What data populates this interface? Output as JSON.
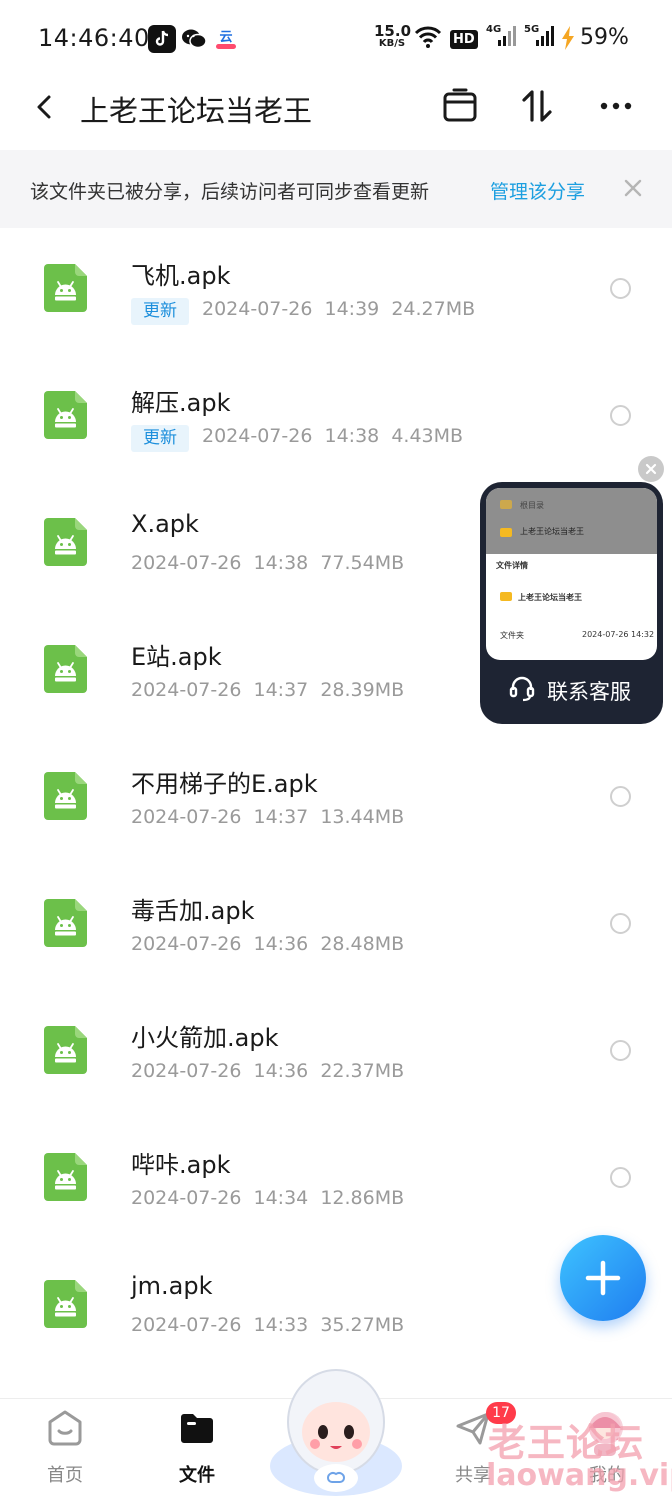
{
  "status_bar": {
    "time": "14:46:40",
    "net_speed_value": "15.0",
    "net_speed_unit": "KB/S",
    "hd_label": "HD",
    "signal1_label": "4G",
    "signal2_label": "5G",
    "battery": "59%",
    "app_icons": [
      "tiktok-icon",
      "wechat-icon",
      "cloud-drive-icon"
    ]
  },
  "header": {
    "title": "上老王论坛当老王",
    "icons": [
      "back-icon",
      "archive-icon",
      "sort-icon",
      "more-icon"
    ]
  },
  "share_banner": {
    "text": "该文件夹已被分享，后续访问者可同步查看更新",
    "link": "管理该分享"
  },
  "files": [
    {
      "name": "飞机.apk",
      "badge": "更新",
      "meta": "2024-07-26  14:39  24.27MB"
    },
    {
      "name": "解压.apk",
      "badge": "更新",
      "meta": "2024-07-26  14:38  4.43MB"
    },
    {
      "name": "X.apk",
      "badge": "",
      "meta": "2024-07-26  14:38  77.54MB"
    },
    {
      "name": "E站.apk",
      "badge": "",
      "meta": "2024-07-26  14:37  28.39MB"
    },
    {
      "name": "不用梯子的E.apk",
      "badge": "",
      "meta": "2024-07-26  14:37  13.44MB"
    },
    {
      "name": "毒舌加.apk",
      "badge": "",
      "meta": "2024-07-26  14:36  28.48MB"
    },
    {
      "name": "小火箭加.apk",
      "badge": "",
      "meta": "2024-07-26  14:36  22.37MB"
    },
    {
      "name": "哔咔.apk",
      "badge": "",
      "meta": "2024-07-26  14:34  12.86MB"
    },
    {
      "name": "jm.apk",
      "badge": "",
      "meta": "2024-07-26  14:33  35.27MB"
    }
  ],
  "float_window": {
    "preview_row1": "根目录",
    "preview_row2": "上老王论坛当老王",
    "preview_section": "文件详情",
    "preview_folder": "上老王论坛当老王",
    "preview_type": "文件夹",
    "preview_time": "2024-07-26 14:32",
    "label": "联系客服"
  },
  "bottom_nav": {
    "items": [
      {
        "label": "首页",
        "icon": "home-icon"
      },
      {
        "label": "文件",
        "icon": "folder-icon"
      },
      {
        "label": "共享",
        "icon": "share-icon"
      },
      {
        "label": "我的",
        "icon": "profile-icon"
      }
    ],
    "share_badge": "17"
  },
  "watermark": {
    "text": "老王论坛",
    "url": "laowang.vip"
  },
  "colors": {
    "accent": "#1d9fe0",
    "apk_green": "#6cc04a",
    "fab_blue": "#1f7df0",
    "badge_red": "#ff3b4a"
  }
}
